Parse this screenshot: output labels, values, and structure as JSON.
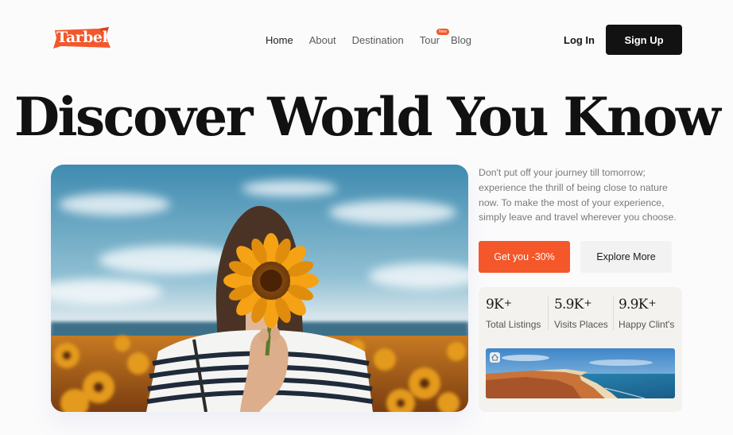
{
  "brand": {
    "name": "Tarbel",
    "color": "#f4572a"
  },
  "nav": {
    "items": [
      {
        "label": "Home"
      },
      {
        "label": "About"
      },
      {
        "label": "Destination"
      },
      {
        "label": "Tour",
        "badge": "New"
      },
      {
        "label": "Blog"
      }
    ],
    "active": "Home"
  },
  "auth": {
    "login_label": "Log In",
    "signup_label": "Sign Up"
  },
  "hero": {
    "title": "Discover World You Know",
    "description": "Don't put off your journey till tomorrow; experience the thrill of being close to nature now. To make the most of your experience, simply leave and travel wherever you choose.",
    "cta_label": "Get you -30%",
    "explore_label": "Explore More"
  },
  "stats": [
    {
      "value": "9K",
      "suffix": "+",
      "label": "Total Listings"
    },
    {
      "value": "5.9K",
      "suffix": "+",
      "label": "Visits Places"
    },
    {
      "value": "9.9K",
      "suffix": "+",
      "label": "Happy Clint's"
    }
  ],
  "icons": {
    "beach_badge": "home-icon"
  }
}
